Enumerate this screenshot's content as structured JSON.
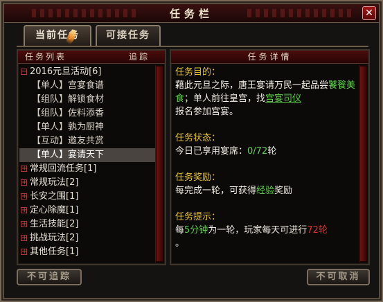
{
  "window": {
    "title": "任务栏",
    "close_label": "✕"
  },
  "tabs": [
    {
      "label": "当前任务",
      "active": true
    },
    {
      "label": "可接任务",
      "active": false
    }
  ],
  "list_panel": {
    "header_left": "任务列表",
    "header_right": "追踪",
    "groups": [
      {
        "label": "2016元旦活动[6]",
        "expanded": true,
        "items": [
          "【单人】宫宴食谱",
          "【组队】解锁食材",
          "【组队】佐料添香",
          "【单人】孰为厨神",
          "【互动】邀友共赏",
          "【单人】宴请天下"
        ],
        "selected_index": 5
      },
      {
        "label": "常规回流任务[1]",
        "expanded": false
      },
      {
        "label": "常规玩法[2]",
        "expanded": false
      },
      {
        "label": "长安之围[1]",
        "expanded": false
      },
      {
        "label": "定心除魔[1]",
        "expanded": false
      },
      {
        "label": "生活技能[2]",
        "expanded": false
      },
      {
        "label": "挑战玩法[2]",
        "expanded": false
      },
      {
        "label": "其他任务[1]",
        "expanded": false
      }
    ],
    "expanded_symbol": "−",
    "collapsed_symbol": "+"
  },
  "detail_panel": {
    "header": "任务详情",
    "goal_title": "任务目的：",
    "goal_text_1": "藉此元旦之际，唐王宴请万民一起品尝",
    "goal_highlight": "饕餮美食",
    "goal_text_2": "；单人前往皇宫，找",
    "goal_link": "宫宴司仪",
    "goal_text_3": "报名参加宫宴。",
    "status_title": "任务状态：",
    "status_text": "今日已享用宴席：",
    "status_value": "0/72",
    "status_unit": "轮",
    "reward_title": "任务奖励：",
    "reward_text_1": "每完成一轮，可获得",
    "reward_highlight": "经验",
    "reward_text_2": "奖励",
    "tip_title": "任务提示：",
    "tip_text_1": "每",
    "tip_highlight": "5分钟",
    "tip_text_2": "为一轮，玩家每天可进行",
    "tip_value": "72轮",
    "tip_text_3": "。"
  },
  "buttons": {
    "untrack": "不可追踪",
    "cancel": "不可取消"
  },
  "colors": {
    "highlight_green": "#5fd14a",
    "heading_yellow": "#e8c234",
    "accent_red": "#e53030",
    "title_bar": "#3a1010"
  }
}
